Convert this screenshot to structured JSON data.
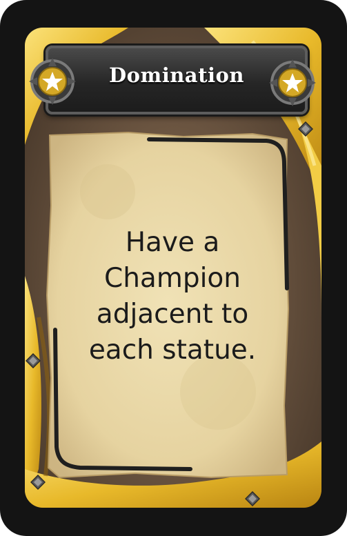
{
  "card": {
    "title": "Domination",
    "objective_lines": [
      "Have a",
      "Champion",
      "adjacent to",
      "each statue."
    ]
  },
  "icons": {
    "left_medallion": "star-icon",
    "right_medallion": "star-icon",
    "corner_gems": "diamond-stud-icon"
  },
  "colors": {
    "card_border": "#141414",
    "gold": "#e8b92a",
    "parchment": "#e8d7a8",
    "banner": "#2a2a2a",
    "title_text": "#ffffff",
    "body_text": "#1b1b1b"
  }
}
